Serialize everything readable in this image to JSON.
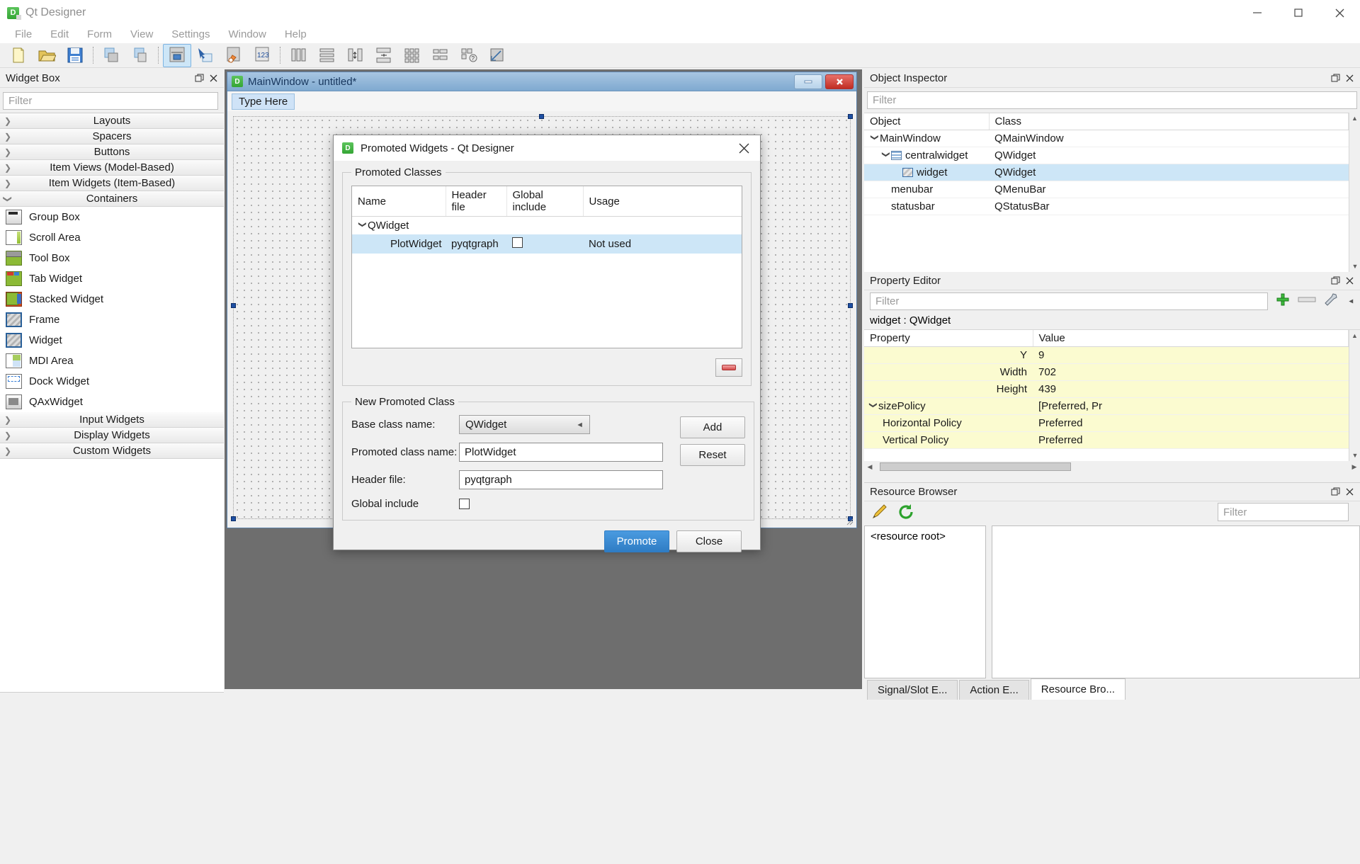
{
  "window": {
    "app_icon": "D",
    "title": "Qt Designer",
    "minimize_label": "Minimize",
    "maximize_label": "Maximize",
    "close_label": "Close"
  },
  "menubar": {
    "items": [
      {
        "label": "File"
      },
      {
        "label": "Edit"
      },
      {
        "label": "Form"
      },
      {
        "label": "View"
      },
      {
        "label": "Settings"
      },
      {
        "label": "Window"
      },
      {
        "label": "Help"
      }
    ]
  },
  "toolbar": {
    "groups": [
      {
        "buttons": [
          {
            "name": "new-form-icon",
            "tip": "New"
          },
          {
            "name": "open-form-icon",
            "tip": "Open"
          },
          {
            "name": "save-form-icon",
            "tip": "Save"
          }
        ]
      },
      {
        "buttons": [
          {
            "name": "undo-icon",
            "tip": "Undo"
          },
          {
            "name": "redo-icon",
            "tip": "Redo"
          }
        ]
      },
      {
        "buttons": [
          {
            "name": "edit-widgets-icon",
            "tip": "Edit Widgets",
            "active": true
          },
          {
            "name": "edit-signals-slots-icon",
            "tip": "Edit Signals/Slots"
          },
          {
            "name": "edit-buddies-icon",
            "tip": "Edit Buddies"
          },
          {
            "name": "edit-tab-order-icon",
            "tip": "Edit Tab Order"
          }
        ]
      },
      {
        "buttons": [
          {
            "name": "layout-horizontally-icon",
            "tip": "Lay Out Horizontally"
          },
          {
            "name": "layout-vertically-icon",
            "tip": "Lay Out Vertically"
          },
          {
            "name": "layout-splitter-h-icon",
            "tip": "Lay Out Horizontally in Splitter"
          },
          {
            "name": "layout-splitter-v-icon",
            "tip": "Lay Out Vertically in Splitter"
          },
          {
            "name": "layout-grid-icon",
            "tip": "Lay Out in a Grid"
          },
          {
            "name": "layout-form-icon",
            "tip": "Lay Out in a Form Layout"
          },
          {
            "name": "break-layout-icon",
            "tip": "Break Layout"
          },
          {
            "name": "adjust-size-icon",
            "tip": "Adjust Size"
          }
        ]
      }
    ]
  },
  "widget_box": {
    "title": "Widget Box",
    "filter_placeholder": "Filter",
    "float_label": "Float",
    "close_label": "Close",
    "categories": [
      {
        "label": "Layouts",
        "expanded": false
      },
      {
        "label": "Spacers",
        "expanded": false
      },
      {
        "label": "Buttons",
        "expanded": false
      },
      {
        "label": "Item Views (Model-Based)",
        "expanded": false
      },
      {
        "label": "Item Widgets (Item-Based)",
        "expanded": false
      },
      {
        "label": "Containers",
        "expanded": true
      }
    ],
    "container_items": [
      {
        "label": "Group Box",
        "icon": "group-box-icon",
        "cls": "ico-groupbox"
      },
      {
        "label": "Scroll Area",
        "icon": "scroll-area-icon",
        "cls": "ico-scroll"
      },
      {
        "label": "Tool Box",
        "icon": "tool-box-icon",
        "cls": "ico-toolbox"
      },
      {
        "label": "Tab Widget",
        "icon": "tab-widget-icon",
        "cls": "ico-tab"
      },
      {
        "label": "Stacked Widget",
        "icon": "stacked-widget-icon",
        "cls": "ico-stacked"
      },
      {
        "label": "Frame",
        "icon": "frame-icon",
        "cls": "ico-frame"
      },
      {
        "label": "Widget",
        "icon": "widget-icon",
        "cls": "ico-frame"
      },
      {
        "label": "MDI Area",
        "icon": "mdi-area-icon",
        "cls": "ico-mdi"
      },
      {
        "label": "Dock Widget",
        "icon": "dock-widget-icon",
        "cls": "ico-dock"
      },
      {
        "label": "QAxWidget",
        "icon": "qax-widget-icon",
        "cls": "ico-qax"
      }
    ],
    "trailing_categories": [
      {
        "label": "Input Widgets",
        "expanded": false
      },
      {
        "label": "Display Widgets",
        "expanded": false
      },
      {
        "label": "Custom Widgets",
        "expanded": false
      }
    ]
  },
  "form_window": {
    "icon": "D",
    "title": "MainWindow - untitled*",
    "minimize_label": "Minimize",
    "close_label": "Close",
    "menu_placeholder": "Type Here"
  },
  "dialog": {
    "icon": "D",
    "title": "Promoted Widgets - Qt Designer",
    "close_label": "Close",
    "promoted_classes": {
      "group_title": "Promoted Classes",
      "columns": [
        "Name",
        "Header file",
        "Global include",
        "Usage"
      ],
      "rows": [
        {
          "name": "QWidget",
          "is_parent": true,
          "expanded": true,
          "header_file": "",
          "global_include": null,
          "usage": "",
          "selected": false
        },
        {
          "name": "PlotWidget",
          "is_parent": false,
          "header_file": "pyqtgraph",
          "global_include": false,
          "usage": "Not used",
          "selected": true
        }
      ],
      "remove_button_label": "Remove"
    },
    "new_promoted_class": {
      "group_title": "New Promoted Class",
      "base_class_label": "Base class name:",
      "base_class_value": "QWidget",
      "promoted_class_label": "Promoted class name:",
      "promoted_class_value": "PlotWidget",
      "header_file_label": "Header file:",
      "header_file_value": "pyqtgraph",
      "global_include_label": "Global include",
      "global_include_checked": false,
      "add_label": "Add",
      "reset_label": "Reset"
    },
    "promote_label": "Promote",
    "close_button_label": "Close"
  },
  "object_inspector": {
    "title": "Object Inspector",
    "filter_placeholder": "Filter",
    "columns": [
      "Object",
      "Class"
    ],
    "rows": [
      {
        "object": "MainWindow",
        "class": "QMainWindow",
        "depth": 0,
        "expanded": true,
        "icon": "",
        "selected": false
      },
      {
        "object": "centralwidget",
        "class": "QWidget",
        "depth": 1,
        "expanded": true,
        "icon": "menubar-i",
        "selected": false
      },
      {
        "object": "widget",
        "class": "QWidget",
        "depth": 2,
        "expanded": null,
        "icon": "widget-i",
        "selected": true
      },
      {
        "object": "menubar",
        "class": "QMenuBar",
        "depth": 1,
        "expanded": null,
        "icon": "",
        "selected": false
      },
      {
        "object": "statusbar",
        "class": "QStatusBar",
        "depth": 1,
        "expanded": null,
        "icon": "",
        "selected": false
      }
    ]
  },
  "property_editor": {
    "title": "Property Editor",
    "filter_placeholder": "Filter",
    "object_line": "widget : QWidget",
    "columns": [
      "Property",
      "Value"
    ],
    "rows": [
      {
        "property": "Y",
        "value": "9",
        "indent": 1,
        "expandable": false
      },
      {
        "property": "Width",
        "value": "702",
        "indent": 1,
        "expandable": false
      },
      {
        "property": "Height",
        "value": "439",
        "indent": 1,
        "expandable": false
      },
      {
        "property": "sizePolicy",
        "value": "[Preferred, Pr",
        "indent": 0,
        "expandable": true
      },
      {
        "property": "Horizontal Policy",
        "value": "Preferred",
        "indent": 1,
        "expandable": false
      },
      {
        "property": "Vertical Policy",
        "value": "Preferred",
        "indent": 1,
        "expandable": false
      }
    ],
    "toolbar_icons": [
      "add-property-icon",
      "sort-property-icon",
      "configure-icon"
    ]
  },
  "resource_browser": {
    "title": "Resource Browser",
    "filter_placeholder": "Filter",
    "edit_icon": "pencil-icon",
    "reload_icon": "reload-icon",
    "root_label": "<resource root>"
  },
  "bottom_tabs": [
    {
      "label": "Signal/Slot E...",
      "active": false
    },
    {
      "label": "Action E...",
      "active": false
    },
    {
      "label": "Resource Bro...",
      "active": true
    }
  ]
}
